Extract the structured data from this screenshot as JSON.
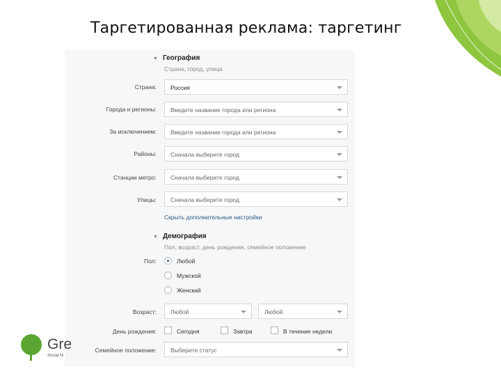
{
  "slide": {
    "title": "Таргетированная реклама: таргетинг"
  },
  "colors": {
    "accent_green": "#5ba532",
    "link_blue": "#2a5885",
    "panel_bg": "#f6f7f8"
  },
  "geo": {
    "title": "География",
    "subtitle": "Страна, город, улица",
    "rows": [
      {
        "label": "Страна:",
        "value": "Россия"
      },
      {
        "label": "Города и регионы:",
        "value": "Введите название города или региона"
      },
      {
        "label": "За исключением:",
        "value": "Введите название города или региона"
      },
      {
        "label": "Районы:",
        "value": "Сначала выберите город"
      },
      {
        "label": "Станции метро:",
        "value": "Сначала выберите город"
      },
      {
        "label": "Улицы:",
        "value": "Сначала выберите город"
      }
    ],
    "more_link": "Скрыть дополнительные настройки"
  },
  "demo": {
    "title": "Демография",
    "subtitle": "Пол, возраст, день рождения, семейное положение",
    "gender_label": "Пол:",
    "gender_options": [
      "Любой",
      "Мужской",
      "Женский"
    ],
    "gender_selected": 0,
    "age_label": "Возраст:",
    "age_from": "Любой",
    "age_to": "Любой",
    "birthday_label": "День рождения:",
    "birthday_options": [
      "Сегодня",
      "Завтра",
      "В течение недели"
    ],
    "marital_label": "Семейное положение:",
    "marital_value": "Выберите статус"
  },
  "logo": {
    "text": "Gre",
    "sub": "Social M"
  }
}
